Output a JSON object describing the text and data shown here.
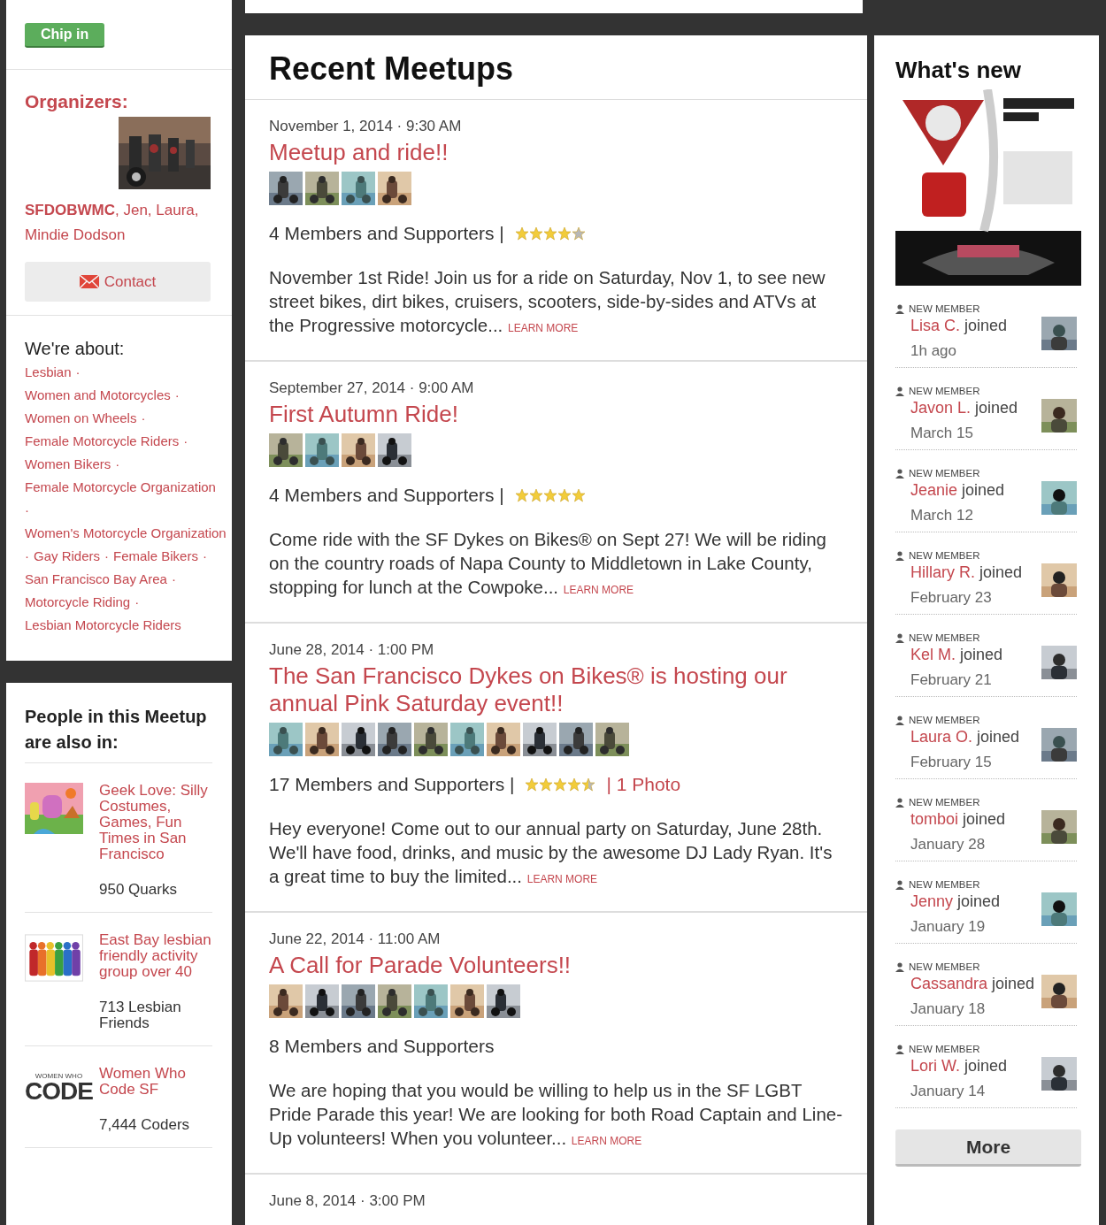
{
  "sidebar": {
    "chip_in": {
      "label": "Chip in"
    },
    "organizers": {
      "title": "Organizers:",
      "names": "**SFDOBWMC**, Jen, Laura, Mindie Dodson",
      "photo": {
        "kind": "picture"
      }
    },
    "contact": {
      "label": "Contact"
    },
    "about": {
      "title": "We're about:",
      "separator": "·",
      "topics": [
        "Lesbian",
        "Women and Motorcycles",
        "Women on Wheels",
        "Female Motorcycle Riders",
        "Women Bikers",
        "Female Motorcycle Organization",
        "Women's Motorcycle Organization",
        "Gay Riders",
        "Female Bikers",
        "San Francisco Bay Area",
        "Motorcycle Riding",
        "Lesbian Motorcycle Riders"
      ]
    },
    "also_in": {
      "title": "People in this Meetup are also in:",
      "groups": [
        {
          "kind": "picture",
          "name": "Geek Love: Silly Costumes, Games, Fun Times in San Francisco",
          "members": "950 Quarks"
        },
        {
          "kind": "silhouettes",
          "name": "East Bay lesbian friendly activity group over 40",
          "members": "713 Lesbian Friends"
        },
        {
          "kind": "wordmark",
          "logo_small": "WOMEN WHO",
          "logo_big": "CODE",
          "name": "Women Who Code SF",
          "members": "7,444 Coders"
        }
      ]
    }
  },
  "meetups": {
    "title": "Recent Meetups",
    "items": [
      {
        "date": "November 1, 2014 · 9:30 AM",
        "title": "Meetup and ride!!",
        "photos": [
          {
            "kind": "picture"
          },
          {
            "kind": "picture"
          },
          {
            "kind": "picture"
          },
          {
            "kind": "picture"
          }
        ],
        "attendance": "4 Members and Supporters |",
        "stars": 4,
        "description": "November 1st Ride! Join us for a ride on Saturday, Nov 1, to see new street bikes, dirt bikes, cruisers, scooters, side-by-sides and ATVs at the Progressive motorcycle...",
        "learn_more": "LEARN MORE"
      },
      {
        "date": "September 27, 2014 · 9:00 AM",
        "title": "First Autumn Ride!",
        "photos": [
          {
            "kind": "picture"
          },
          {
            "kind": "picture"
          },
          {
            "kind": "picture"
          },
          {
            "kind": "picture"
          }
        ],
        "attendance": "4 Members and Supporters |",
        "stars": 5,
        "description": "Come ride with the SF Dykes on Bikes® on Sept 27! We will be riding on the country roads of Napa County to Middletown in Lake County, stopping for lunch at the Cowpoke...",
        "learn_more": "LEARN MORE"
      },
      {
        "date": "June 28, 2014 · 1:00 PM",
        "title": "The San Francisco Dykes on Bikes® is hosting our annual Pink Saturday event!!",
        "photos": [
          {
            "kind": "picture"
          },
          {
            "kind": "picture"
          },
          {
            "kind": "picture"
          },
          {
            "kind": "picture"
          },
          {
            "kind": "picture"
          },
          {
            "kind": "picture"
          },
          {
            "kind": "picture"
          },
          {
            "kind": "picture"
          },
          {
            "kind": "picture"
          },
          {
            "kind": "picture"
          }
        ],
        "attendance": "17 Members and Supporters |",
        "stars": 4.5,
        "photo_link": "| 1 Photo",
        "description": "Hey everyone! Come out to our annual party on Saturday, June 28th. We'll have food, drinks, and music by the awesome DJ Lady Ryan. It's a great time to buy the limited...",
        "learn_more": "LEARN MORE"
      },
      {
        "date": "June 22, 2014 · 11:00 AM",
        "title": "A Call for Parade Volunteers!!",
        "photos": [
          {
            "kind": "picture"
          },
          {
            "kind": "picture"
          },
          {
            "kind": "picture"
          },
          {
            "kind": "picture"
          },
          {
            "kind": "picture"
          },
          {
            "kind": "picture"
          },
          {
            "kind": "picture"
          }
        ],
        "attendance": "8 Members and Supporters",
        "description": "We are hoping that you would be willing to help us in the SF LGBT Pride Parade this year! We are looking for both Road Captain and Line-Up volunteers! When you volunteer...",
        "learn_more": "LEARN MORE"
      },
      {
        "date": "June 8, 2014 · 3:00 PM"
      }
    ]
  },
  "whats_new": {
    "title": "What's new",
    "poster": {
      "kind": "picture"
    },
    "items": [
      {
        "badge": "NEW MEMBER",
        "name": "Lisa C.",
        "action": "joined",
        "time": "1h ago"
      },
      {
        "badge": "NEW MEMBER",
        "name": "Javon L.",
        "action": "joined",
        "time": "March 15"
      },
      {
        "badge": "NEW MEMBER",
        "name": "Jeanie",
        "action": "joined",
        "time": "March 12"
      },
      {
        "badge": "NEW MEMBER",
        "name": "Hillary R.",
        "action": "joined",
        "time": "February 23"
      },
      {
        "badge": "NEW MEMBER",
        "name": "Kel M.",
        "action": "joined",
        "time": "February 21"
      },
      {
        "badge": "NEW MEMBER",
        "name": "Laura O.",
        "action": "joined",
        "time": "February 15"
      },
      {
        "badge": "NEW MEMBER",
        "name": "tomboi",
        "action": "joined",
        "time": "January 28"
      },
      {
        "badge": "NEW MEMBER",
        "name": "Jenny",
        "action": "joined",
        "time": "January 19"
      },
      {
        "badge": "NEW MEMBER",
        "name": "Cassandra",
        "action": "joined",
        "time": "January 18"
      },
      {
        "badge": "NEW MEMBER",
        "name": "Lori W.",
        "action": "joined",
        "time": "January 14"
      }
    ],
    "more": "More"
  }
}
